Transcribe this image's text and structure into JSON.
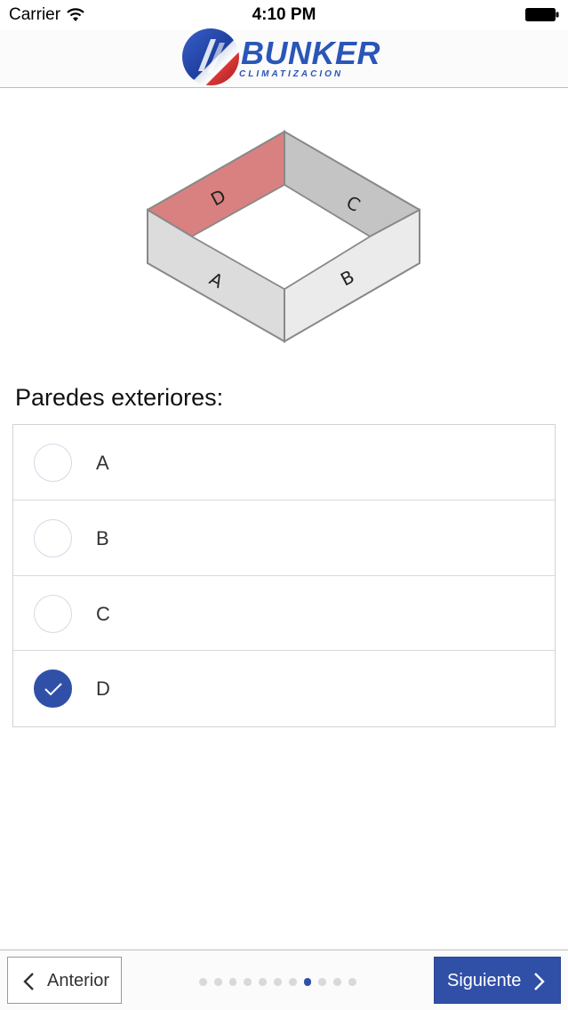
{
  "status_bar": {
    "carrier": "Carrier",
    "time": "4:10 PM",
    "icons": [
      "wifi-icon",
      "battery-icon"
    ]
  },
  "header": {
    "logo_name": "BUNKER",
    "logo_subtitle": "CLIMATIZACION",
    "brand_color": "#2a56b8"
  },
  "diagram": {
    "labels": {
      "a": "A",
      "b": "B",
      "c": "C",
      "d": "D"
    },
    "highlight_color": "#d97878",
    "highlighted_wall": "D"
  },
  "question": {
    "title": "Paredes exteriores:",
    "options": [
      {
        "label": "A",
        "selected": false
      },
      {
        "label": "B",
        "selected": false
      },
      {
        "label": "C",
        "selected": false
      },
      {
        "label": "D",
        "selected": true
      }
    ]
  },
  "toolbar": {
    "prev_label": "Anterior",
    "next_label": "Siguiente",
    "page_count": 11,
    "current_page": 8,
    "accent_color": "#3050a8"
  }
}
